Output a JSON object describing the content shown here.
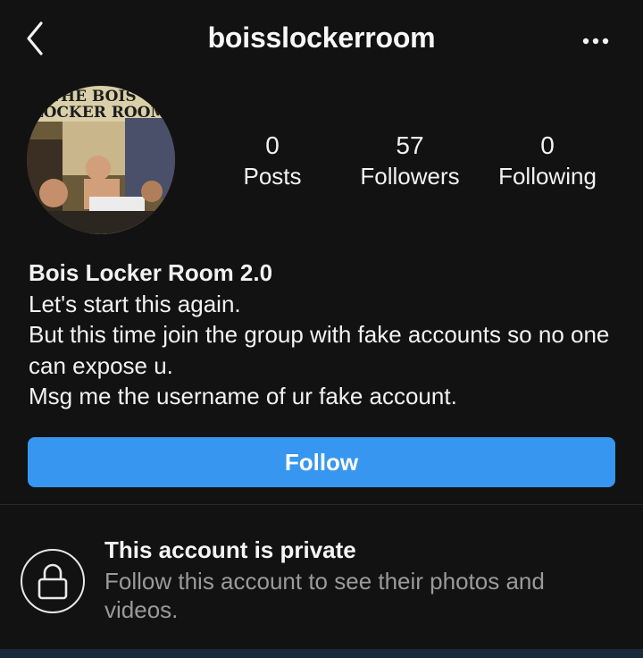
{
  "header": {
    "username": "boisslockerroom",
    "back_icon": "chevron-left-icon",
    "more_icon": "more-horizontal-icon"
  },
  "profile": {
    "avatar_text_line1": "THE BOIS",
    "avatar_text_line2": "LOCKER ROOM",
    "stats": {
      "posts": {
        "count": "0",
        "label": "Posts"
      },
      "followers": {
        "count": "57",
        "label": "Followers"
      },
      "following": {
        "count": "0",
        "label": "Following"
      }
    }
  },
  "bio": {
    "name": "Bois Locker Room 2.0",
    "lines": [
      "Let's start this again.",
      "But this time join the group with fake accounts so no one can expose u.",
      "Msg me the username of ur fake account."
    ]
  },
  "follow_button": {
    "label": "Follow",
    "color": "#3796f0"
  },
  "private_notice": {
    "title": "This account is private",
    "description": "Follow this account to see their photos and videos.",
    "icon": "lock-icon"
  }
}
